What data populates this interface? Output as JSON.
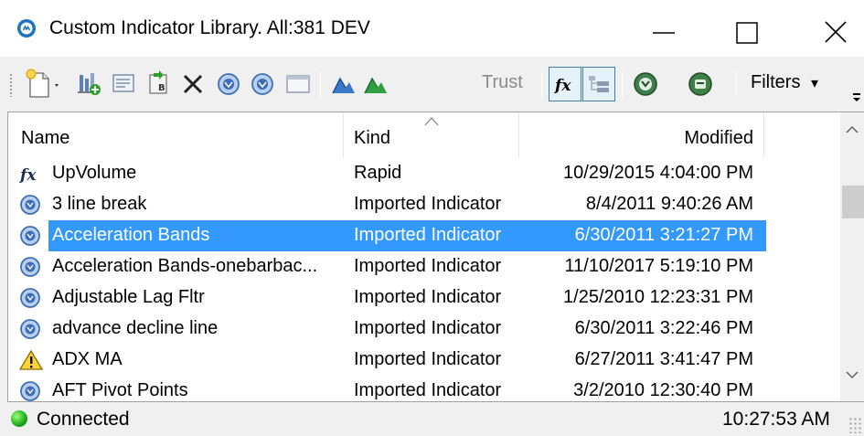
{
  "window": {
    "title": "Custom Indicator Library. All:381 DEV"
  },
  "toolbar": {
    "trust_label": "Trust",
    "filters_label": "Filters",
    "filters_arrow": "▾"
  },
  "columns": {
    "name": "Name",
    "kind": "Kind",
    "modified": "Modified"
  },
  "rows": [
    {
      "icon": "fx-icon",
      "name": "UpVolume",
      "kind": "Rapid",
      "modified": "10/29/2015 4:04:00 PM",
      "selected": false
    },
    {
      "icon": "imported-indicator-icon",
      "name": "3 line break",
      "kind": "Imported Indicator",
      "modified": "8/4/2011 9:40:26 AM",
      "selected": false
    },
    {
      "icon": "imported-indicator-icon",
      "name": "Acceleration Bands",
      "kind": "Imported Indicator",
      "modified": "6/30/2011 3:21:27 PM",
      "selected": true
    },
    {
      "icon": "imported-indicator-icon",
      "name": "Acceleration Bands-onebarbac...",
      "kind": "Imported Indicator",
      "modified": "11/10/2017 5:19:10 PM",
      "selected": false
    },
    {
      "icon": "imported-indicator-icon",
      "name": "Adjustable Lag Fltr",
      "kind": "Imported Indicator",
      "modified": "1/25/2010 12:23:31 PM",
      "selected": false
    },
    {
      "icon": "imported-indicator-icon",
      "name": "advance decline line",
      "kind": "Imported Indicator",
      "modified": "6/30/2011 3:22:46 PM",
      "selected": false
    },
    {
      "icon": "warning-icon",
      "name": "ADX MA",
      "kind": "Imported Indicator",
      "modified": "6/27/2011 3:41:47 PM",
      "selected": false
    },
    {
      "icon": "imported-indicator-icon",
      "name": "AFT Pivot Points",
      "kind": "Imported Indicator",
      "modified": "3/2/2010 12:30:40 PM",
      "selected": false
    }
  ],
  "status": {
    "connection": "Connected",
    "time": "10:27:53 AM"
  },
  "colors": {
    "selection": "#3399ff",
    "accent": "#1e73be",
    "connected": "#1fb21f"
  }
}
